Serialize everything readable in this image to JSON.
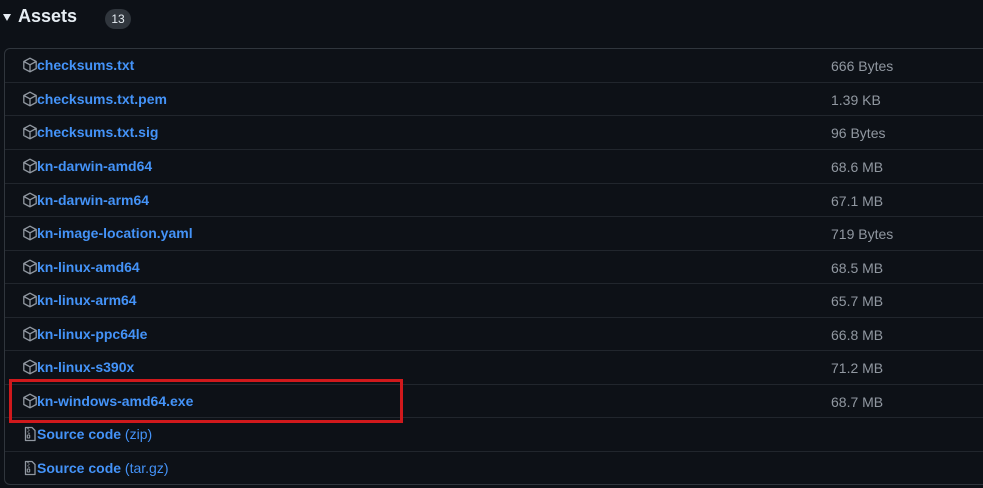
{
  "assets_section": {
    "title": "Assets",
    "count": "13"
  },
  "assets": [
    {
      "name": "checksums.txt",
      "size": "666 Bytes",
      "icon": "package-icon"
    },
    {
      "name": "checksums.txt.pem",
      "size": "1.39 KB",
      "icon": "package-icon"
    },
    {
      "name": "checksums.txt.sig",
      "size": "96 Bytes",
      "icon": "package-icon"
    },
    {
      "name": "kn-darwin-amd64",
      "size": "68.6 MB",
      "icon": "package-icon"
    },
    {
      "name": "kn-darwin-arm64",
      "size": "67.1 MB",
      "icon": "package-icon"
    },
    {
      "name": "kn-image-location.yaml",
      "size": "719 Bytes",
      "icon": "package-icon"
    },
    {
      "name": "kn-linux-amd64",
      "size": "68.5 MB",
      "icon": "package-icon"
    },
    {
      "name": "kn-linux-arm64",
      "size": "65.7 MB",
      "icon": "package-icon"
    },
    {
      "name": "kn-linux-ppc64le",
      "size": "66.8 MB",
      "icon": "package-icon"
    },
    {
      "name": "kn-linux-s390x",
      "size": "71.2 MB",
      "icon": "package-icon"
    },
    {
      "name": "kn-windows-amd64.exe",
      "size": "68.7 MB",
      "icon": "package-icon"
    }
  ],
  "source_code": [
    {
      "label": "Source code",
      "format": "(zip)",
      "icon": "file-zip-icon"
    },
    {
      "label": "Source code",
      "format": "(tar.gz)",
      "icon": "file-zip-icon"
    }
  ],
  "highlighted_asset": "kn-windows-amd64.exe",
  "colors": {
    "background": "#0d1117",
    "link": "#4493f8",
    "muted": "#9198a1",
    "border": "#30363d",
    "highlight": "#d0191c"
  }
}
